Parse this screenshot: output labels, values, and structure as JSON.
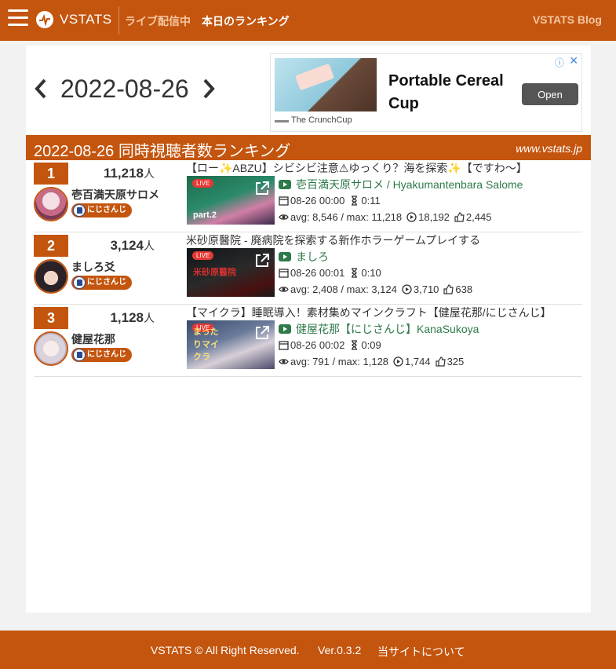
{
  "navbar": {
    "brand": "VSTATS",
    "live_link": "ライブ配信中",
    "ranking_link": "本日のランキング",
    "blog_link": "VSTATS Blog"
  },
  "date_nav": {
    "date": "2022-08-26"
  },
  "ad": {
    "title": "Portable Cereal Cup",
    "button": "Open",
    "brand": "The CrunchCup",
    "close_symbol": "✕",
    "info_symbol": "ⓘ"
  },
  "ranking": {
    "title": "2022-08-26 同時視聴者数ランキング",
    "site": "www.vstats.jp",
    "viewer_unit": "人",
    "entries": [
      {
        "rank": "1",
        "viewers": "11,218",
        "name": "壱百満天原サロメ",
        "org": "にじさんじ",
        "stream_title": "【ロー✨ABZU】シビシビ注意⚠ゆっくり？海を探索✨【ですわ～】",
        "thumb_text": "part.2",
        "live": "LIVE",
        "channel": "壱百満天原サロメ / Hyakumantenbara Salome",
        "start": "08-26 00:00",
        "duration": "0:11",
        "avg_max": "avg: 8,546 / max: 11,218",
        "plays": "18,192",
        "likes": "2,445"
      },
      {
        "rank": "2",
        "viewers": "3,124",
        "name": "ましろ爻",
        "org": "にじさんじ",
        "stream_title": "米砂原醫院 - 廃病院を探索する新作ホラーゲームプレイする",
        "thumb_text": "米砂原醫院",
        "live": "LIVE",
        "channel": "ましろ",
        "start": "08-26 00:01",
        "duration": "0:10",
        "avg_max": "avg: 2,408 / max: 3,124",
        "plays": "3,710",
        "likes": "638"
      },
      {
        "rank": "3",
        "viewers": "1,128",
        "name": "健屋花那",
        "org": "にじさんじ",
        "stream_title": "【マイクラ】睡眠導入！素材集めマインクラフト【健屋花那/にじさんじ】",
        "thumb_text": "まったりマイクラ",
        "live": "LIVE",
        "channel": "健屋花那【にじさんじ】KanaSukoya",
        "start": "08-26 00:02",
        "duration": "0:09",
        "avg_max": "avg: 791 / max: 1,128",
        "plays": "1,744",
        "likes": "325"
      }
    ]
  },
  "footer": {
    "copyright": "VSTATS © All Right Reserved.",
    "version": "Ver.0.3.2",
    "about": "当サイトについて"
  },
  "colors": {
    "primary": "#c4550e",
    "channel_link": "#2e7a4a",
    "background": "#f2f2f2"
  },
  "icons": [
    "menu-icon",
    "pulse-logo-icon",
    "chevron-left-icon",
    "chevron-right-icon",
    "external-link-icon",
    "youtube-icon",
    "calendar-icon",
    "hourglass-icon",
    "eye-icon",
    "play-circle-icon",
    "thumbs-up-icon"
  ]
}
